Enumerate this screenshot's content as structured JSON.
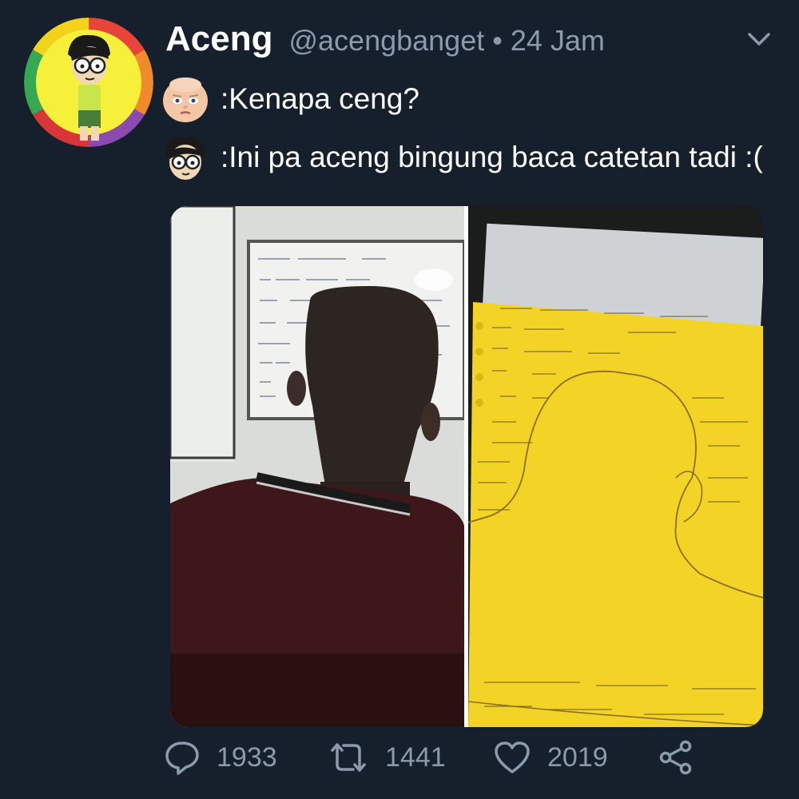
{
  "tweet": {
    "display_name": "Aceng",
    "handle": "@acengbanget",
    "separator": "•",
    "time": "24 Jam",
    "lines": [
      {
        "text": ":Kenapa ceng?",
        "emoji": "baby-face-emoji"
      },
      {
        "text": ":Ini pa aceng bingung baca catetan tadi :(",
        "emoji": "glasses-face-emoji"
      }
    ],
    "images": [
      {
        "description_icon": "photo-classroom-whiteboard"
      },
      {
        "description_icon": "photo-yellow-notes-head-drawing"
      }
    ]
  },
  "actions": {
    "reply": {
      "count": "1933",
      "icon": "reply-icon"
    },
    "retweet": {
      "count": "1441",
      "icon": "retweet-icon"
    },
    "like": {
      "count": "2019",
      "icon": "heart-icon"
    },
    "share": {
      "icon": "share-icon"
    }
  },
  "colors": {
    "background": "#16202c",
    "secondary_text": "#8a9bac",
    "primary_text": "#ffffff",
    "note_paper": "#f4d327"
  }
}
